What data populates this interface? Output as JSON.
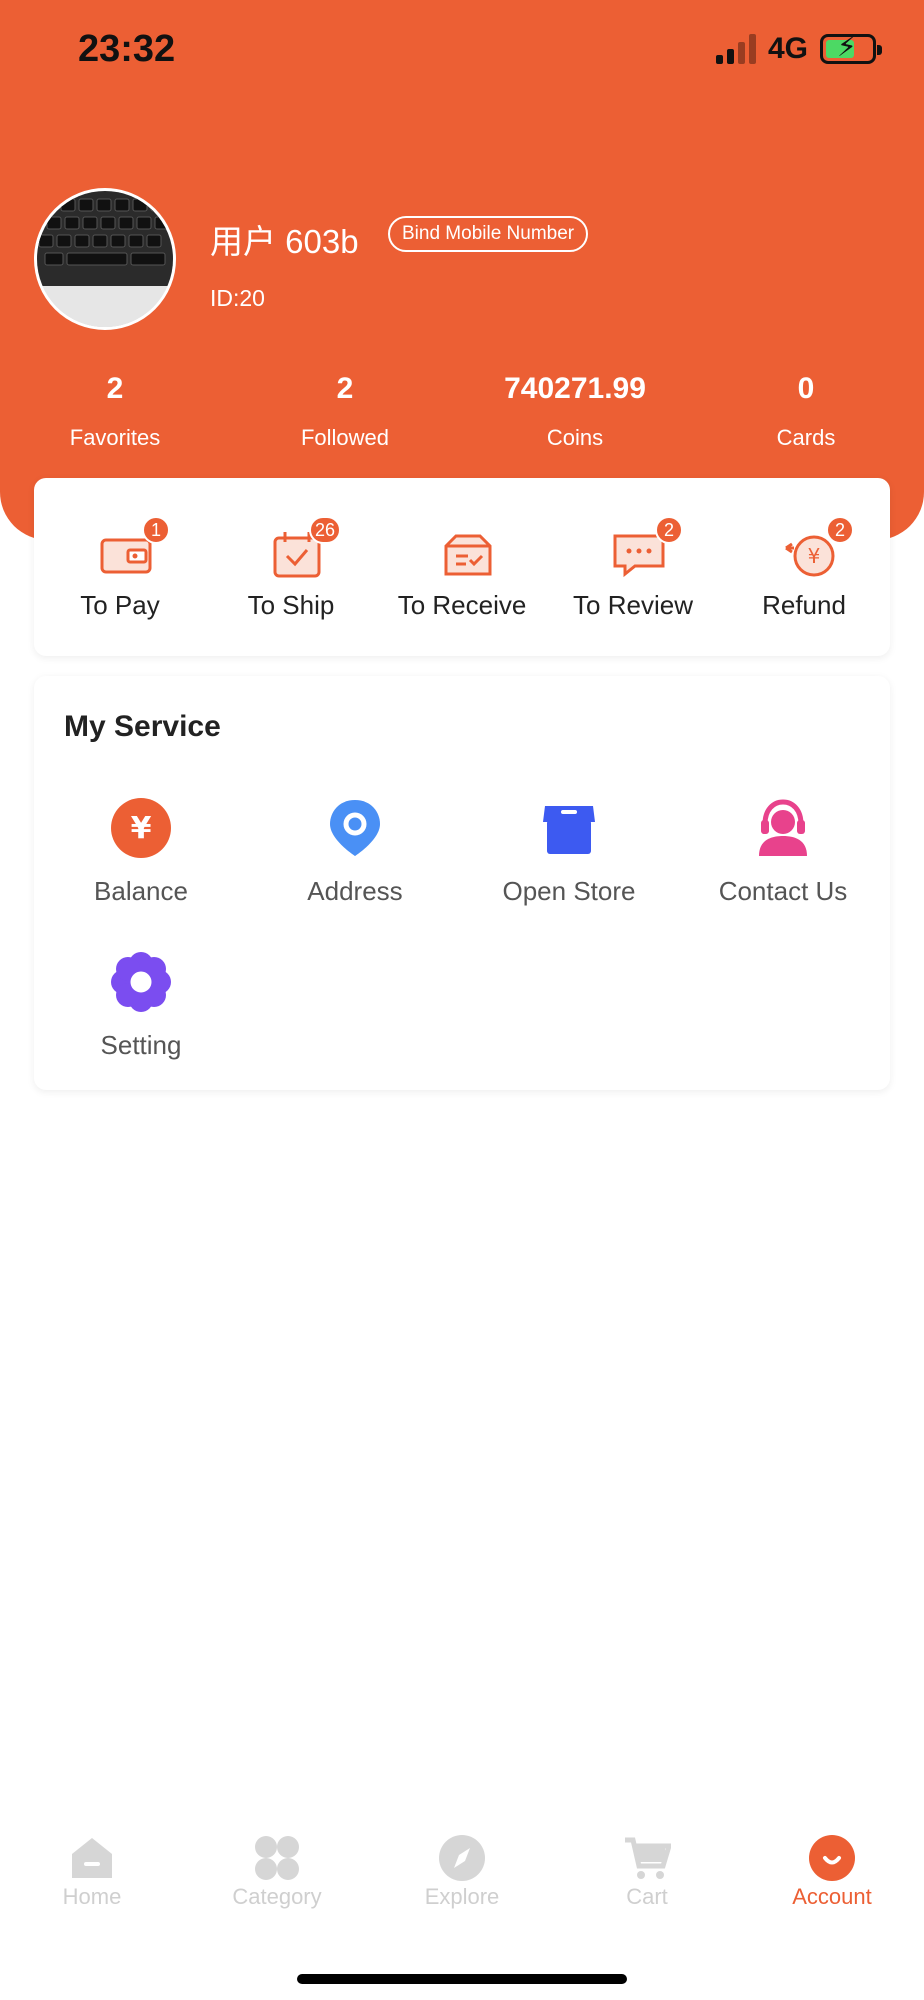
{
  "status_bar": {
    "time": "23:32",
    "network": "4G"
  },
  "profile": {
    "name": "用户 603b",
    "bind_label": "Bind Mobile Number",
    "id_text": "ID:20"
  },
  "stats": [
    {
      "value": "2",
      "label": "Favorites"
    },
    {
      "value": "2",
      "label": "Followed"
    },
    {
      "value": "740271.99",
      "label": "Coins"
    },
    {
      "value": "0",
      "label": "Cards"
    }
  ],
  "orders": [
    {
      "label": "To Pay",
      "badge": "1",
      "icon": "wallet-icon"
    },
    {
      "label": "To Ship",
      "badge": "26",
      "icon": "calendar-check-icon"
    },
    {
      "label": "To Receive",
      "badge": "",
      "icon": "package-icon"
    },
    {
      "label": "To Review",
      "badge": "2",
      "icon": "chat-bubble-icon"
    },
    {
      "label": "Refund",
      "badge": "2",
      "icon": "yen-refund-icon"
    }
  ],
  "service": {
    "title": "My Service",
    "items": [
      {
        "label": "Balance",
        "icon": "yen-coin-icon",
        "color": "#EC5F34"
      },
      {
        "label": "Address",
        "icon": "location-pin-icon",
        "color": "#4A90F5"
      },
      {
        "label": "Open Store",
        "icon": "store-icon",
        "color": "#3D5AF1"
      },
      {
        "label": "Contact Us",
        "icon": "headset-agent-icon",
        "color": "#E8428C"
      },
      {
        "label": "Setting",
        "icon": "settings-flower-icon",
        "color": "#7B4DF0"
      }
    ]
  },
  "tabbar": {
    "items": [
      {
        "label": "Home",
        "icon": "home-icon",
        "active": false
      },
      {
        "label": "Category",
        "icon": "category-icon",
        "active": false
      },
      {
        "label": "Explore",
        "icon": "compass-icon",
        "active": false
      },
      {
        "label": "Cart",
        "icon": "cart-icon",
        "active": false
      },
      {
        "label": "Account",
        "icon": "account-icon",
        "active": true
      }
    ]
  },
  "colors": {
    "brand": "#EC5F34",
    "inactive_tab": "#cfcfcf"
  }
}
